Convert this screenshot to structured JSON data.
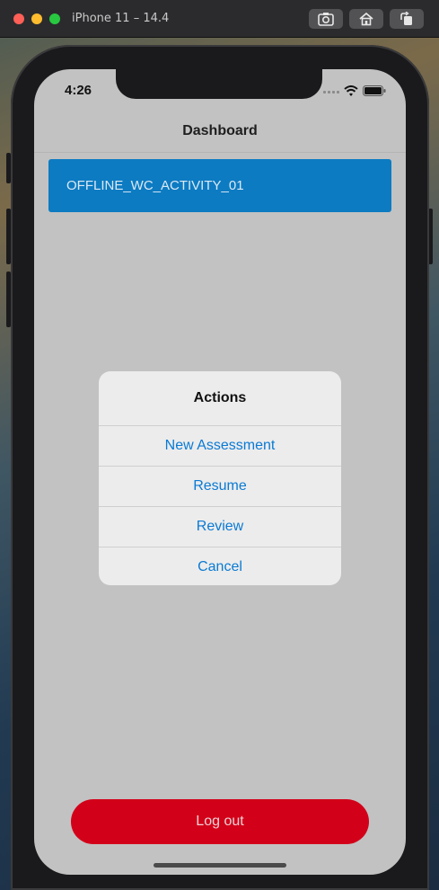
{
  "window": {
    "title": "iPhone 11 – 14.4",
    "toolbar_icons": [
      "screenshot-icon",
      "home-icon",
      "rotate-icon"
    ]
  },
  "status_bar": {
    "time": "4:26",
    "icons": [
      "signal-icon",
      "wifi-icon",
      "battery-icon"
    ]
  },
  "navbar": {
    "title": "Dashboard"
  },
  "activities": [
    {
      "label": "OFFLINE_WC_ACTIVITY_01"
    }
  ],
  "action_sheet": {
    "title": "Actions",
    "actions": [
      {
        "label": "New Assessment"
      },
      {
        "label": "Resume"
      },
      {
        "label": "Review"
      },
      {
        "label": "Cancel"
      }
    ]
  },
  "footer": {
    "logout_label": "Log out"
  },
  "colors": {
    "primary_blue": "#0c7bc2",
    "action_blue": "#0a7ad4",
    "logout_red": "#d30019",
    "screen_dim": "#c2c2c2"
  }
}
